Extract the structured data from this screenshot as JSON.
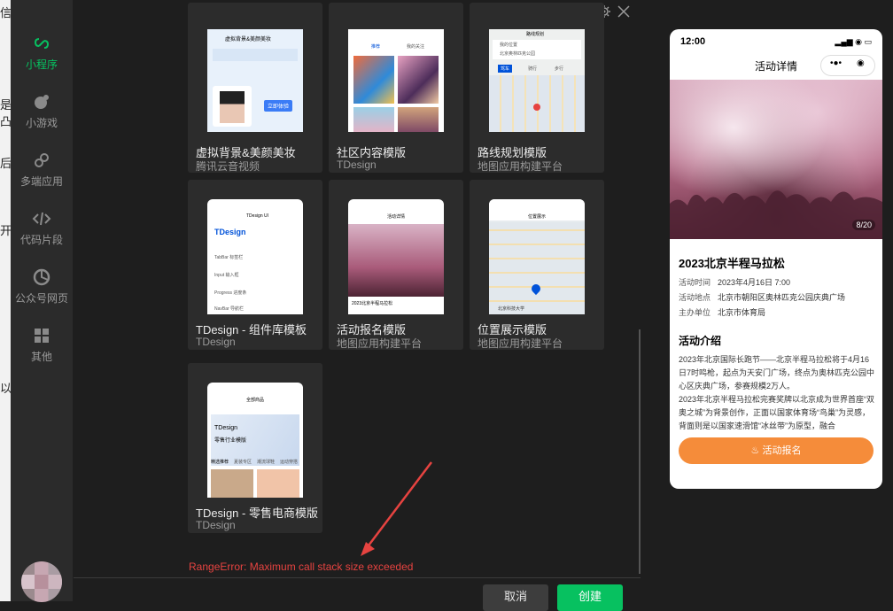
{
  "behind": {
    "fragments": [
      "信",
      "是凸",
      "后",
      "开",
      "以"
    ]
  },
  "sidebar": {
    "items": [
      {
        "label": "小程序",
        "icon": "link-icon"
      },
      {
        "label": "小游戏",
        "icon": "game-icon"
      },
      {
        "label": "多端应用",
        "icon": "multi-link-icon"
      },
      {
        "label": "代码片段",
        "icon": "code-icon"
      },
      {
        "label": "公众号网页",
        "icon": "aperture-icon"
      },
      {
        "label": "其他",
        "icon": "grid-icon"
      }
    ]
  },
  "templates": [
    {
      "title": "虚拟背景&美颜美妆",
      "subtitle": "腾讯云音视频"
    },
    {
      "title": "社区内容模版",
      "subtitle": "TDesign"
    },
    {
      "title": "路线规划模版",
      "subtitle": "地图应用构建平台"
    },
    {
      "title": "TDesign - 组件库模板",
      "subtitle": "TDesign"
    },
    {
      "title": "活动报名模版",
      "subtitle": "地图应用构建平台"
    },
    {
      "title": "位置展示模版",
      "subtitle": "地图应用构建平台"
    },
    {
      "title": "TDesign - 零售电商模版",
      "subtitle": "TDesign"
    }
  ],
  "thumbs": {
    "beauty": {
      "heading": "虚拟背景&美颜美妆",
      "btn": "立即体验"
    },
    "community": {
      "tab1": "推荐",
      "tab2": "我的关注"
    },
    "route": {
      "from": "我的位置",
      "to": "北京奥林匹克公园",
      "title": "路线规划",
      "modes": [
        "驾车",
        "骑行",
        "步行"
      ]
    },
    "tdesign": {
      "title": "TDesign UI",
      "logo": "TDesign",
      "rows": [
        "TabBar 标签栏",
        "Input 输入框",
        "Progress 进度条",
        "NavBar 导航栏"
      ]
    },
    "event": {
      "title": "活动详情",
      "caption": "2023北京半程马拉松"
    },
    "location": {
      "title": "位置展示",
      "caption": "北京科技大学"
    },
    "retail": {
      "title": "全部商品",
      "banner": "TDesign",
      "banner_sub": "零售行业模版",
      "tabs": [
        "精选推荐",
        "夏装专区",
        "潮流球鞋",
        "运动穿搭"
      ]
    }
  },
  "error": "RangeError: Maximum call stack size exceeded",
  "buttons": {
    "cancel": "取消",
    "create": "创建"
  },
  "preview": {
    "time": "12:00",
    "nav_title": "活动详情",
    "image_counter": "8/20",
    "title": "2023北京半程马拉松",
    "info": [
      {
        "label": "活动时间",
        "value": "2023年4月16日 7:00"
      },
      {
        "label": "活动地点",
        "value": "北京市朝阳区奥林匹克公园庆典广场"
      },
      {
        "label": "主办单位",
        "value": "北京市体育局"
      }
    ],
    "section_title": "活动介绍",
    "paragraphs": [
      "2023年北京国际长跑节——北京半程马拉松将于4月16日7时鸣枪，起点为天安门广场，终点为奥林匹克公园中心区庆典广场，参赛规模2万人。",
      "2023年北京半程马拉松完赛奖牌以北京成为世界首座“双奥之城”为背景创作，正面以国家体育场“鸟巢”为灵感，背面则是以国家速滑馆“冰丝带”为原型，融合"
    ],
    "signup": "活动报名"
  },
  "colors": {
    "accent": "#07c160",
    "error": "#e64340",
    "signup": "#f58c3a"
  }
}
